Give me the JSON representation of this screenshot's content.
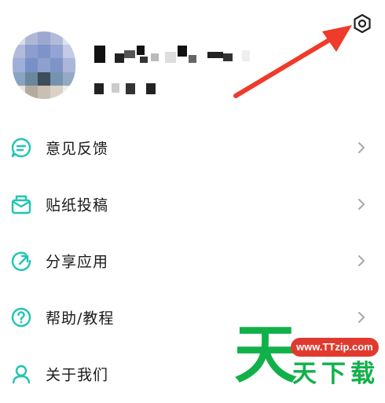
{
  "settings": {
    "icon": "gear-icon"
  },
  "profile": {
    "name_obscured": "",
    "id_obscured": ""
  },
  "menu": [
    {
      "label": "意见反馈",
      "icon": "feedback-chat-icon"
    },
    {
      "label": "贴纸投稿",
      "icon": "mail-icon"
    },
    {
      "label": "分享应用",
      "icon": "share-refresh-icon"
    },
    {
      "label": "帮助/教程",
      "icon": "help-question-icon"
    },
    {
      "label": "关于我们",
      "icon": "user-icon"
    }
  ],
  "watermark": {
    "big": "天",
    "badge": "www.TTzip.com",
    "text": "天下载"
  },
  "colors": {
    "accent": "#1fc4b4",
    "arrow": "#ee3b2a",
    "watermark_green": "#11b14a",
    "badge_red": "#e03a2f"
  }
}
